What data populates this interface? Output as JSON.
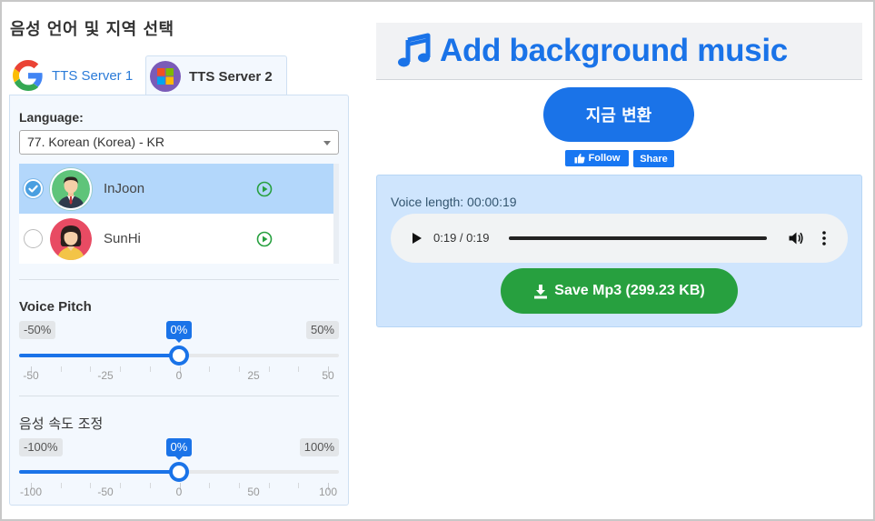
{
  "section_title": "음성 언어 및 지역 선택",
  "tabs": [
    {
      "label": "TTS Server 1",
      "icon": "google-icon",
      "active": false
    },
    {
      "label": "TTS Server 2",
      "icon": "microsoft-icon",
      "active": true
    }
  ],
  "language": {
    "label": "Language:",
    "selected": "77. Korean (Korea) - KR"
  },
  "voices": [
    {
      "name": "InJoon",
      "selected": true,
      "avatar": "male-avatar",
      "action_icon": "play-circle-icon"
    },
    {
      "name": "SunHi",
      "selected": false,
      "avatar": "female-avatar",
      "action_icon": "play-circle-icon"
    }
  ],
  "pitch": {
    "title": "Voice Pitch",
    "min_label": "-50%",
    "max_label": "50%",
    "value_label": "0%",
    "min": -50,
    "max": 50,
    "value": 0,
    "tick_labels": [
      "-50",
      "-25",
      "0",
      "25",
      "50"
    ]
  },
  "speed": {
    "title": "음성 속도 조정",
    "min_label": "-100%",
    "max_label": "100%",
    "value_label": "0%",
    "min": -100,
    "max": 100,
    "value": 0,
    "tick_labels": [
      "-100",
      "-50",
      "0",
      "50",
      "100"
    ]
  },
  "music": {
    "title": "Add background music",
    "icon": "music-note-icon"
  },
  "convert_button": "지금 변환",
  "social": {
    "follow": "Follow",
    "share": "Share"
  },
  "result": {
    "voice_length": "Voice length: 00:00:19",
    "audio_time": "0:19 / 0:19",
    "progress": 1.0,
    "save_button": "Save Mp3 (299.23 KB)"
  },
  "colors": {
    "primary": "#1a73e8",
    "success": "#27a03f",
    "selected_row": "#b3d7fb",
    "panel_bg": "#f3f8fe",
    "result_bg": "#cfe5fd"
  }
}
